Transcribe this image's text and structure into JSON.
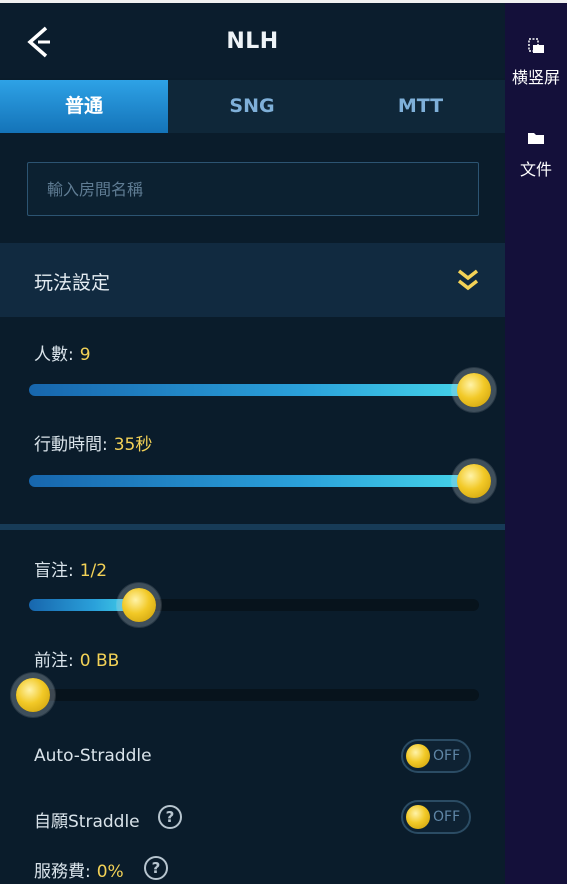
{
  "header": {
    "title": "NLH"
  },
  "tabs": [
    {
      "label": "普通",
      "active": true
    },
    {
      "label": "SNG",
      "active": false
    },
    {
      "label": "MTT",
      "active": false
    }
  ],
  "room_name": {
    "placeholder": "輸入房間名稱",
    "value": ""
  },
  "section": {
    "title": "玩法設定"
  },
  "settings": {
    "players": {
      "label": "人數:",
      "value": "9",
      "fraction": 1.0
    },
    "action_time": {
      "label": "行動時間:",
      "value": "35秒",
      "fraction": 1.0
    },
    "blinds": {
      "label": "盲注:",
      "value": "1/2",
      "fraction": 0.24
    },
    "ante": {
      "label": "前注:",
      "value": "0 BB",
      "fraction": 0.0
    },
    "auto_straddle": {
      "label": "Auto-Straddle",
      "state": "OFF"
    },
    "voluntary_straddle": {
      "label": "自願Straddle",
      "state": "OFF"
    },
    "service_fee": {
      "label": "服務費:",
      "value": "0%"
    }
  },
  "side_toolbar": {
    "orientation": {
      "label": "横竖屏",
      "icon": "orientation-icon"
    },
    "files": {
      "label": "文件",
      "icon": "folder-icon"
    }
  },
  "colors": {
    "accent": "#2ea2e6",
    "highlight": "#f3d257",
    "background": "#0a1c2b",
    "sidebar": "#14103a"
  }
}
